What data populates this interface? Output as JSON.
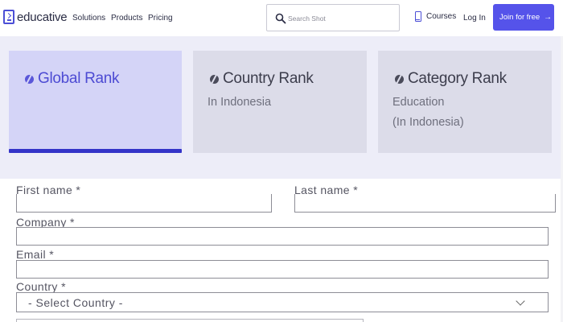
{
  "header": {
    "logo_text": "educative",
    "nav": {
      "solutions": "Solutions",
      "products": "Products",
      "pricing": "Pricing"
    },
    "search": {
      "placeholder": "Search Shot",
      "value": ""
    },
    "courses_label": "Courses",
    "login_label": "Log In",
    "join_label": "Join for free",
    "join_arrow": "→",
    "accent_color": "#5553ea"
  },
  "rank_tabs": [
    {
      "title": "Global Rank",
      "active": true
    },
    {
      "title": "Country Rank",
      "subtitle": "In Indonesia",
      "active": false
    },
    {
      "title": "Category Rank",
      "subtitle": "Education",
      "subtitle_2": "(In Indonesia)",
      "active": false
    }
  ],
  "form": {
    "first_name_label": "First name *",
    "last_name_label": "Last name *",
    "company_label": "Company *",
    "email_label": "Email *",
    "country_label": "Country *",
    "country_select_value": "- Select Country -"
  },
  "icons": {
    "logo": "educative-logo-icon",
    "search": "search-icon",
    "courses": "tablet-icon",
    "rank": "rank-icon",
    "select": "chevron-down-icon"
  }
}
